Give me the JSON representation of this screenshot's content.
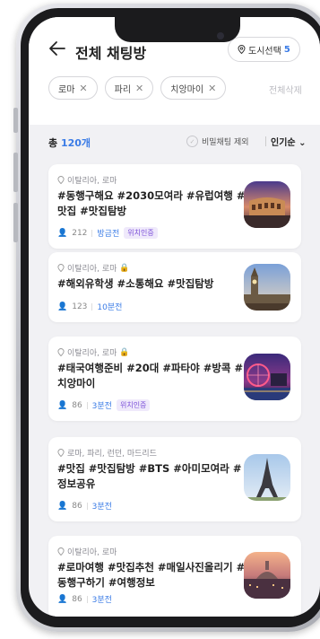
{
  "header": {
    "back_icon": "arrow-left-icon",
    "title": "전체 채팅방",
    "city_button": {
      "label": "도시선택",
      "count": "5"
    }
  },
  "chips": [
    {
      "label": "로마"
    },
    {
      "label": "파리"
    },
    {
      "label": "치앙마이"
    }
  ],
  "clear_all": "전체삭제",
  "filter": {
    "total_prefix": "총 ",
    "total_count": "120개",
    "secret_exclude": "비밀채팅 제외",
    "sort": "인기순 ⌄"
  },
  "rooms": [
    {
      "location": "이탈리아, 로마",
      "locked": false,
      "title": "#동행구해요 #2030모여라 #유럽여행 #맛집 #맛집탐방",
      "members": "212",
      "time": "방금전",
      "badge": "위치인증",
      "thumb": "colosseum"
    },
    {
      "location": "이탈리아, 로마",
      "locked": true,
      "title": "#해외유학생 #소통해요 #맛집탐방",
      "members": "123",
      "time": "10분전",
      "badge": "",
      "thumb": "bigben"
    },
    {
      "location": "이탈리아, 로마",
      "locked": true,
      "title": "#태국여행준비 #20대 #파타야 #방콕 #치앙마이",
      "members": "86",
      "time": "3분전",
      "badge": "위치인증",
      "thumb": "londoneye"
    },
    {
      "location": "로마, 파리, 런던, 마드리드",
      "locked": false,
      "title": "#맛집 #맛집탐방 #BTS #아미모여라 #정보공유",
      "members": "86",
      "time": "3분전",
      "badge": "",
      "thumb": "eiffel"
    },
    {
      "location": "이탈리아, 로마",
      "locked": false,
      "title": "#로마여행 #맛집추천 #매일사진올리기 #동행구하기 #여행정보",
      "members": "86",
      "time": "3분전",
      "badge": "",
      "thumb": "rome"
    }
  ]
}
